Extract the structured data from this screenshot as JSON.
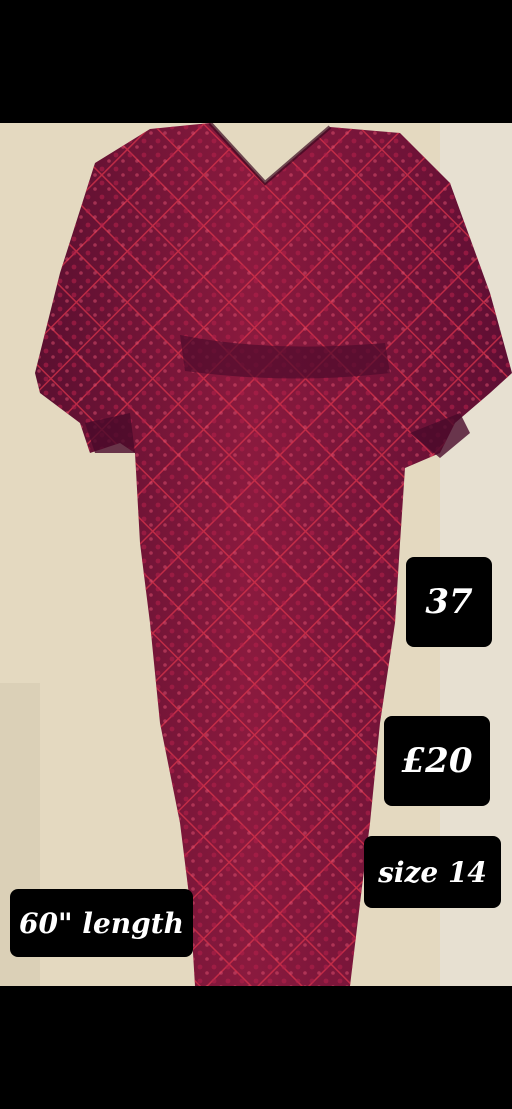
{
  "image": {
    "subject": "sequin-dress-photo",
    "colors": {
      "dress": "#7a1538",
      "dress_dark": "#4e0c2c",
      "sequin": "#d8324a",
      "wall": "#e3d8bf",
      "background": "#000000",
      "tag_bg": "#000000",
      "tag_text": "#ffffff"
    }
  },
  "labels": {
    "number": "37",
    "price": "£20",
    "size": "size 14",
    "length": "60\" length"
  }
}
